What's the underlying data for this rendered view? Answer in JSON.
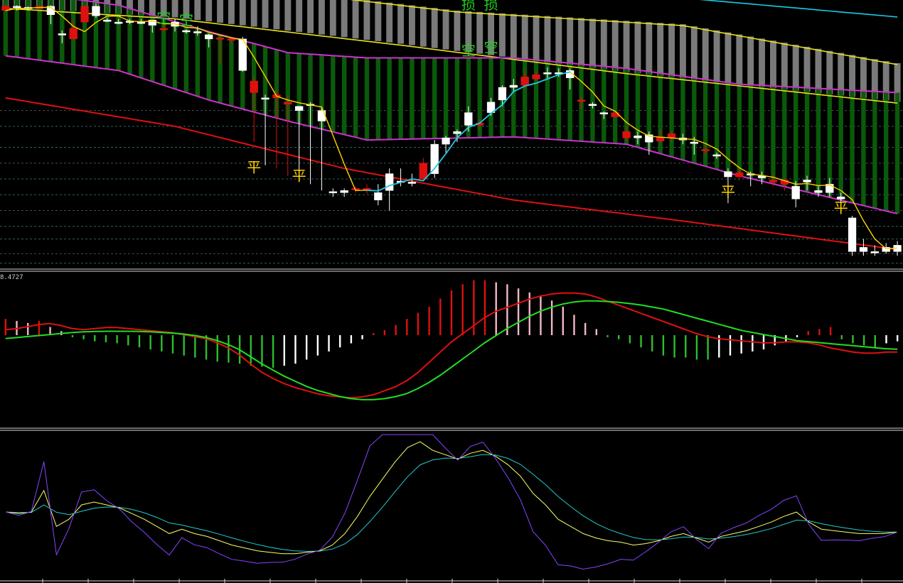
{
  "chart_data": [
    {
      "panel": "price",
      "type": "candlestick",
      "title": "",
      "colors": {
        "bull_candle": "#ffffff",
        "bear_candle": "#e01010",
        "band_upper": "#cc33cc",
        "band_fill": "#0a5a0a",
        "cloud_fill": "#7a7a7a",
        "ma_fast": "#ffd400",
        "ma_cyan": "#1cc8e8",
        "ma_long_red": "#e01010",
        "ma_yellow_upper": "#e8e020"
      },
      "annotations": [
        {
          "text": "损",
          "color": "#22cc22",
          "x_index": 41,
          "y": 0.962
        },
        {
          "text": "损",
          "color": "#22cc22",
          "x_index": 43,
          "y": 0.962
        },
        {
          "text": "空",
          "color": "#22cc22",
          "x_index": 14,
          "y": 0.835
        },
        {
          "text": "空",
          "color": "#22cc22",
          "x_index": 16,
          "y": 0.815
        },
        {
          "text": "空",
          "color": "#22cc22",
          "x_index": 41,
          "y": 0.525
        },
        {
          "text": "空",
          "color": "#22cc22",
          "x_index": 43,
          "y": 0.555
        },
        {
          "text": "平",
          "color": "#ffd400",
          "x_index": 22,
          "y": -0.585
        },
        {
          "text": "平",
          "color": "#ffd400",
          "x_index": 26,
          "y": -0.668
        },
        {
          "text": "平",
          "color": "#ffd400",
          "x_index": 64,
          "y": -0.82
        },
        {
          "text": "平",
          "color": "#ffd400",
          "x_index": 74,
          "y": -0.97
        }
      ],
      "candles": [
        {
          "o": 0.99,
          "h": 1.02,
          "l": 0.93,
          "c": 0.95
        },
        {
          "o": 0.98,
          "h": 1.0,
          "l": 0.95,
          "c": 0.99
        },
        {
          "o": 0.97,
          "h": 0.99,
          "l": 0.95,
          "c": 0.98
        },
        {
          "o": 0.99,
          "h": 1.01,
          "l": 0.96,
          "c": 0.97
        },
        {
          "o": 0.91,
          "h": 1.0,
          "l": 0.82,
          "c": 0.99
        },
        {
          "o": 0.72,
          "h": 0.76,
          "l": 0.64,
          "c": 0.73
        },
        {
          "o": 0.78,
          "h": 0.86,
          "l": 0.68,
          "c": 0.68
        },
        {
          "o": 0.99,
          "h": 1.0,
          "l": 0.84,
          "c": 0.84
        },
        {
          "o": 0.9,
          "h": 1.02,
          "l": 0.88,
          "c": 0.99
        },
        {
          "o": 0.86,
          "h": 0.88,
          "l": 0.84,
          "c": 0.86
        },
        {
          "o": 0.84,
          "h": 0.87,
          "l": 0.82,
          "c": 0.84
        },
        {
          "o": 0.84,
          "h": 0.87,
          "l": 0.82,
          "c": 0.85
        },
        {
          "o": 0.84,
          "h": 0.87,
          "l": 0.82,
          "c": 0.84
        },
        {
          "o": 0.81,
          "h": 0.84,
          "l": 0.74,
          "c": 0.86
        },
        {
          "o": 0.78,
          "h": 0.83,
          "l": 0.75,
          "c": 0.77
        },
        {
          "o": 0.8,
          "h": 0.87,
          "l": 0.75,
          "c": 0.84
        },
        {
          "o": 0.75,
          "h": 0.77,
          "l": 0.73,
          "c": 0.76
        },
        {
          "o": 0.74,
          "h": 0.8,
          "l": 0.71,
          "c": 0.75
        },
        {
          "o": 0.68,
          "h": 0.73,
          "l": 0.6,
          "c": 0.72
        },
        {
          "o": 0.69,
          "h": 0.71,
          "l": 0.45,
          "c": 0.68
        },
        {
          "o": 0.68,
          "h": 0.7,
          "l": 0.64,
          "c": 0.67
        },
        {
          "o": 0.38,
          "h": 0.7,
          "l": 0.37,
          "c": 0.68
        },
        {
          "o": 0.28,
          "h": 0.32,
          "l": -0.3,
          "c": 0.17
        },
        {
          "o": 0.12,
          "h": 0.15,
          "l": -0.52,
          "c": 0.12
        },
        {
          "o": 0.15,
          "h": 0.2,
          "l": -0.55,
          "c": 0.12
        },
        {
          "o": 0.08,
          "h": 0.14,
          "l": -0.62,
          "c": 0.06
        },
        {
          "o": 0.0,
          "h": 0.04,
          "l": -0.65,
          "c": 0.04
        },
        {
          "o": 0.05,
          "h": 0.08,
          "l": -0.7,
          "c": 0.06
        },
        {
          "o": -0.1,
          "h": 0.04,
          "l": -0.76,
          "c": 0.0
        },
        {
          "o": -0.78,
          "h": -0.74,
          "l": -0.82,
          "c": -0.77
        },
        {
          "o": -0.78,
          "h": -0.74,
          "l": -0.82,
          "c": -0.76
        },
        {
          "o": -0.74,
          "h": -0.72,
          "l": -0.78,
          "c": -0.75
        },
        {
          "o": -0.74,
          "h": -0.7,
          "l": -0.79,
          "c": -0.76
        },
        {
          "o": -0.85,
          "h": -0.7,
          "l": -0.9,
          "c": -0.78
        },
        {
          "o": -0.76,
          "h": -0.55,
          "l": -0.95,
          "c": -0.6
        },
        {
          "o": -0.68,
          "h": -0.55,
          "l": -0.72,
          "c": -0.67
        },
        {
          "o": -0.68,
          "h": -0.6,
          "l": -0.72,
          "c": -0.68
        },
        {
          "o": -0.5,
          "h": -0.45,
          "l": -0.63,
          "c": -0.65
        },
        {
          "o": -0.6,
          "h": -0.28,
          "l": -0.64,
          "c": -0.32
        },
        {
          "o": -0.32,
          "h": -0.24,
          "l": -0.4,
          "c": -0.26
        },
        {
          "o": -0.22,
          "h": -0.18,
          "l": -0.3,
          "c": -0.2
        },
        {
          "o": -0.14,
          "h": 0.04,
          "l": -0.2,
          "c": -0.02
        },
        {
          "o": -0.12,
          "h": -0.08,
          "l": -0.18,
          "c": -0.14
        },
        {
          "o": -0.02,
          "h": 0.12,
          "l": -0.05,
          "c": 0.08
        },
        {
          "o": 0.1,
          "h": 0.24,
          "l": 0.04,
          "c": 0.22
        },
        {
          "o": 0.22,
          "h": 0.3,
          "l": 0.17,
          "c": 0.24
        },
        {
          "o": 0.32,
          "h": 0.38,
          "l": 0.21,
          "c": 0.24
        },
        {
          "o": 0.34,
          "h": 0.38,
          "l": 0.28,
          "c": 0.3
        },
        {
          "o": 0.35,
          "h": 0.41,
          "l": 0.3,
          "c": 0.36
        },
        {
          "o": 0.35,
          "h": 0.4,
          "l": 0.32,
          "c": 0.36
        },
        {
          "o": 0.31,
          "h": 0.4,
          "l": 0.2,
          "c": 0.38
        },
        {
          "o": 0.1,
          "h": 0.13,
          "l": 0.02,
          "c": 0.09
        },
        {
          "o": 0.05,
          "h": 0.08,
          "l": 0.02,
          "c": 0.06
        },
        {
          "o": -0.03,
          "h": -0.01,
          "l": -0.08,
          "c": -0.02
        },
        {
          "o": -0.02,
          "h": 0.0,
          "l": -0.07,
          "c": -0.06
        },
        {
          "o": -0.2,
          "h": -0.15,
          "l": -0.3,
          "c": -0.26
        },
        {
          "o": -0.26,
          "h": -0.2,
          "l": -0.32,
          "c": -0.24
        },
        {
          "o": -0.3,
          "h": -0.2,
          "l": -0.42,
          "c": -0.23
        },
        {
          "o": -0.25,
          "h": -0.18,
          "l": -0.3,
          "c": -0.29
        },
        {
          "o": -0.22,
          "h": -0.2,
          "l": -0.3,
          "c": -0.26
        },
        {
          "o": -0.28,
          "h": -0.22,
          "l": -0.32,
          "c": -0.26
        },
        {
          "o": -0.3,
          "h": -0.25,
          "l": -0.42,
          "c": -0.3
        },
        {
          "o": -0.37,
          "h": -0.33,
          "l": -0.42,
          "c": -0.38
        },
        {
          "o": -0.43,
          "h": -0.4,
          "l": -0.46,
          "c": -0.42
        },
        {
          "o": -0.63,
          "h": -0.55,
          "l": -0.88,
          "c": -0.58
        },
        {
          "o": -0.59,
          "h": -0.54,
          "l": -0.66,
          "c": -0.63
        },
        {
          "o": -0.6,
          "h": -0.58,
          "l": -0.72,
          "c": -0.6
        },
        {
          "o": -0.64,
          "h": -0.58,
          "l": -0.7,
          "c": -0.62
        },
        {
          "o": -0.66,
          "h": -0.6,
          "l": -0.72,
          "c": -0.68
        },
        {
          "o": -0.66,
          "h": -0.64,
          "l": -0.76,
          "c": -0.7
        },
        {
          "o": -0.84,
          "h": -0.67,
          "l": -0.92,
          "c": -0.72
        },
        {
          "o": -0.68,
          "h": -0.62,
          "l": -0.76,
          "c": -0.66
        },
        {
          "o": -0.78,
          "h": -0.72,
          "l": -0.82,
          "c": -0.76
        },
        {
          "o": -0.78,
          "h": -0.64,
          "l": -0.82,
          "c": -0.7
        },
        {
          "o": -0.84,
          "h": -0.78,
          "l": -0.9,
          "c": -0.82
        },
        {
          "o": -1.34,
          "h": -1.0,
          "l": -1.38,
          "c": -1.02
        },
        {
          "o": -1.34,
          "h": -1.22,
          "l": -1.38,
          "c": -1.3
        },
        {
          "o": -1.34,
          "h": -1.28,
          "l": -1.38,
          "c": -1.34
        },
        {
          "o": -1.34,
          "h": -1.26,
          "l": -1.36,
          "c": -1.3
        },
        {
          "o": -1.34,
          "h": -1.24,
          "l": -1.38,
          "c": -1.28
        }
      ]
    },
    {
      "panel": "macd",
      "type": "bar+line",
      "label_value": "8.4727",
      "colors": {
        "bar_up_dark": "#e01010",
        "bar_up_light": "#f4b8c8",
        "bar_down_dark": "#2dbf2d",
        "bar_down_light": "#ffffff",
        "dif": "#e01010",
        "dea": "#22dd22"
      },
      "histogram": [
        0.8,
        0.7,
        0.6,
        0.7,
        0.4,
        0.2,
        -0.1,
        -0.2,
        -0.3,
        -0.35,
        -0.4,
        -0.5,
        -0.6,
        -0.7,
        -0.8,
        -0.9,
        -1.0,
        -1.1,
        -1.2,
        -1.3,
        -1.35,
        -1.4,
        -1.5,
        -1.55,
        -1.6,
        -1.5,
        -1.4,
        -1.2,
        -1.0,
        -0.8,
        -0.6,
        -0.4,
        -0.2,
        0.1,
        0.25,
        0.5,
        0.8,
        1.1,
        1.4,
        1.8,
        2.2,
        2.5,
        2.7,
        2.7,
        2.6,
        2.5,
        2.3,
        2.1,
        1.9,
        1.7,
        1.4,
        1.0,
        0.6,
        0.3,
        -0.1,
        -0.2,
        -0.4,
        -0.6,
        -0.8,
        -1.0,
        -1.1,
        -1.1,
        -1.2,
        -1.2,
        -1.1,
        -1.0,
        -0.9,
        -0.8,
        -0.7,
        -0.5,
        -0.3,
        -0.1,
        0.2,
        0.3,
        0.4,
        -0.2,
        -0.4,
        -0.5,
        -0.6,
        -0.4,
        -0.3
      ],
      "dif": [
        0.9,
        0.95,
        1.05,
        1.15,
        1.2,
        1.1,
        0.95,
        0.9,
        0.95,
        1.0,
        1.0,
        0.95,
        0.9,
        0.85,
        0.8,
        0.75,
        0.65,
        0.55,
        0.45,
        0.25,
        0.0,
        -0.35,
        -0.8,
        -1.2,
        -1.5,
        -1.75,
        -1.95,
        -2.1,
        -2.25,
        -2.35,
        -2.4,
        -2.45,
        -2.4,
        -2.3,
        -2.1,
        -1.9,
        -1.6,
        -1.2,
        -0.7,
        -0.2,
        0.3,
        0.7,
        1.1,
        1.5,
        1.8,
        2.0,
        2.2,
        2.4,
        2.55,
        2.65,
        2.7,
        2.7,
        2.65,
        2.5,
        2.3,
        2.1,
        1.9,
        1.7,
        1.5,
        1.3,
        1.1,
        0.9,
        0.7,
        0.55,
        0.45,
        0.4,
        0.35,
        0.3,
        0.25,
        0.25,
        0.3,
        0.3,
        0.25,
        0.15,
        0.0,
        -0.1,
        -0.2,
        -0.25,
        -0.25,
        -0.2,
        -0.2
      ],
      "dea": [
        0.6,
        0.65,
        0.7,
        0.75,
        0.8,
        0.85,
        0.9,
        0.93,
        0.95,
        0.96,
        0.96,
        0.96,
        0.95,
        0.93,
        0.9,
        0.87,
        0.82,
        0.75,
        0.65,
        0.5,
        0.3,
        0.05,
        -0.3,
        -0.65,
        -0.95,
        -1.25,
        -1.5,
        -1.75,
        -1.95,
        -2.1,
        -2.25,
        -2.35,
        -2.4,
        -2.4,
        -2.35,
        -2.25,
        -2.1,
        -1.85,
        -1.55,
        -1.2,
        -0.8,
        -0.4,
        0.0,
        0.4,
        0.75,
        1.1,
        1.4,
        1.7,
        1.95,
        2.15,
        2.3,
        2.4,
        2.45,
        2.45,
        2.42,
        2.38,
        2.32,
        2.25,
        2.15,
        2.05,
        1.9,
        1.75,
        1.6,
        1.45,
        1.3,
        1.15,
        1.0,
        0.9,
        0.8,
        0.7,
        0.6,
        0.5,
        0.45,
        0.4,
        0.35,
        0.3,
        0.25,
        0.2,
        0.15,
        0.1,
        0.08
      ]
    },
    {
      "panel": "kdj",
      "type": "line",
      "colors": {
        "k": "#ffff66",
        "d": "#22cccc",
        "j": "#8844ff"
      },
      "k": [
        45,
        44,
        45,
        60,
        35,
        40,
        50,
        52,
        50,
        48,
        44,
        40,
        35,
        30,
        33,
        30,
        28,
        25,
        22,
        20,
        18,
        17,
        16,
        16,
        17,
        18,
        22,
        30,
        42,
        56,
        68,
        80,
        90,
        94,
        88,
        85,
        82,
        86,
        88,
        84,
        78,
        70,
        58,
        50,
        40,
        35,
        30,
        27,
        25,
        24,
        22,
        23,
        25,
        28,
        30,
        27,
        24,
        28,
        30,
        32,
        35,
        38,
        42,
        45,
        38,
        33,
        32,
        31,
        30,
        30,
        30,
        31
      ]
    }
  ]
}
